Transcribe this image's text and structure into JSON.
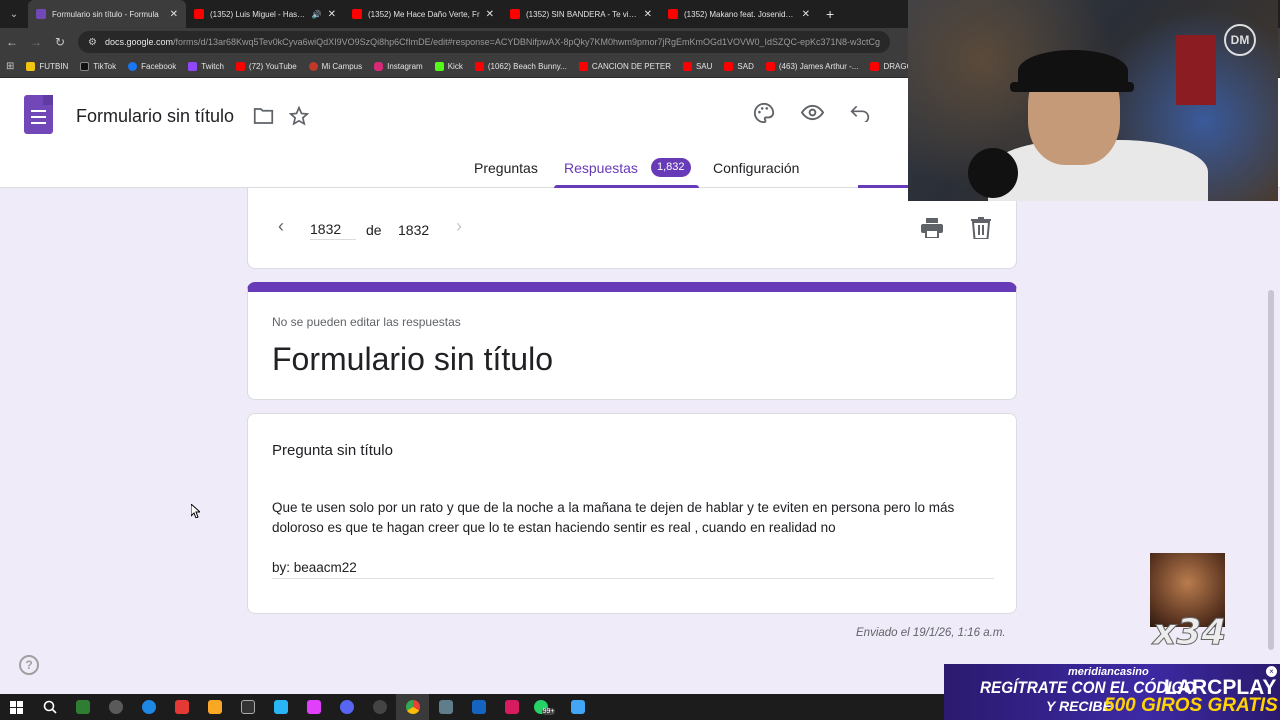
{
  "browser": {
    "tabs": [
      {
        "title": "Formulario sin título - Formula",
        "active": true,
        "icon": "forms-icon"
      },
      {
        "title": "(1352) Luis Miguel - Hasta q",
        "active": false,
        "icon": "youtube-icon",
        "audio": true
      },
      {
        "title": "(1352) Me Hace Daño Verte, Fr",
        "active": false,
        "icon": "youtube-icon"
      },
      {
        "title": "(1352) SIN BANDERA - Te vi ver",
        "active": false,
        "icon": "youtube-icon"
      },
      {
        "title": "(1352) Makano feat. Josenid - S",
        "active": false,
        "icon": "youtube-icon"
      }
    ],
    "close_glyph": "✕",
    "new_tab_glyph": "+",
    "url_host": "docs.google.com",
    "url_path": "/forms/d/13ar68Kwq5Tev0kCyva6wiQdXI9VO9SzQi8hp6CfImDE/edit#response=ACYDBNifpwAX-8pQky7KM0hwm9pmor7jRgEmKmOGd1VOVW0_IdSZQC-epKc371N8-w3ctCg",
    "bookmarks": [
      {
        "label": "FUTBIN",
        "icon": "fut"
      },
      {
        "label": "TikTok",
        "icon": "tk"
      },
      {
        "label": "Facebook",
        "icon": "fb"
      },
      {
        "label": "Twitch",
        "icon": "tw"
      },
      {
        "label": "(72) YouTube",
        "icon": "yt"
      },
      {
        "label": "Mi Campus",
        "icon": "mc"
      },
      {
        "label": "Instagram",
        "icon": "ig"
      },
      {
        "label": "Kick",
        "icon": "kick"
      },
      {
        "label": "(1062) Beach Bunny...",
        "icon": "yt"
      },
      {
        "label": "CANCION DE PETER",
        "icon": "yt"
      },
      {
        "label": "SAU",
        "icon": "yt"
      },
      {
        "label": "SAD",
        "icon": "yt"
      },
      {
        "label": "(463) James Arthur -...",
        "icon": "yt"
      },
      {
        "label": "DRAGO",
        "icon": "yt"
      }
    ]
  },
  "forms": {
    "doc_title": "Formulario sin título",
    "tabs": {
      "questions": "Preguntas",
      "responses": "Respuestas",
      "responses_count": "1,832",
      "settings": "Configuración"
    },
    "pager": {
      "current": "1832",
      "of": "de",
      "total": "1832"
    },
    "response": {
      "notice": "No se pueden editar las respuestas",
      "form_title": "Formulario sin título",
      "question_title": "Pregunta sin título",
      "answer_text": "Que te usen solo por un rato y que de la noche a la mañana te dejen de hablar y te eviten en persona pero lo más doloroso es que te hagan creer que lo te estan haciendo sentir es real , cuando en realidad no",
      "answer_signature": "by: beaacm22",
      "submitted": "Enviado el 19/1/26, 1:16 a.m."
    },
    "help_glyph": "?"
  },
  "overlays": {
    "webcam_logo": "DM",
    "meme_counter": "x34",
    "ad": {
      "brand": "meridiancasino",
      "line1": "REGÍTRATE CON EL CÓDIGO",
      "code": "LARCPLAY",
      "line2": "Y RECIBE",
      "offer": "500 GIROS GRATIS",
      "close": "×"
    }
  },
  "taskbar": {
    "badge": "99+"
  },
  "colors": {
    "forms_purple": "#673ab7",
    "page_bg": "#f0ebf8",
    "youtube_red": "#ff0000"
  }
}
